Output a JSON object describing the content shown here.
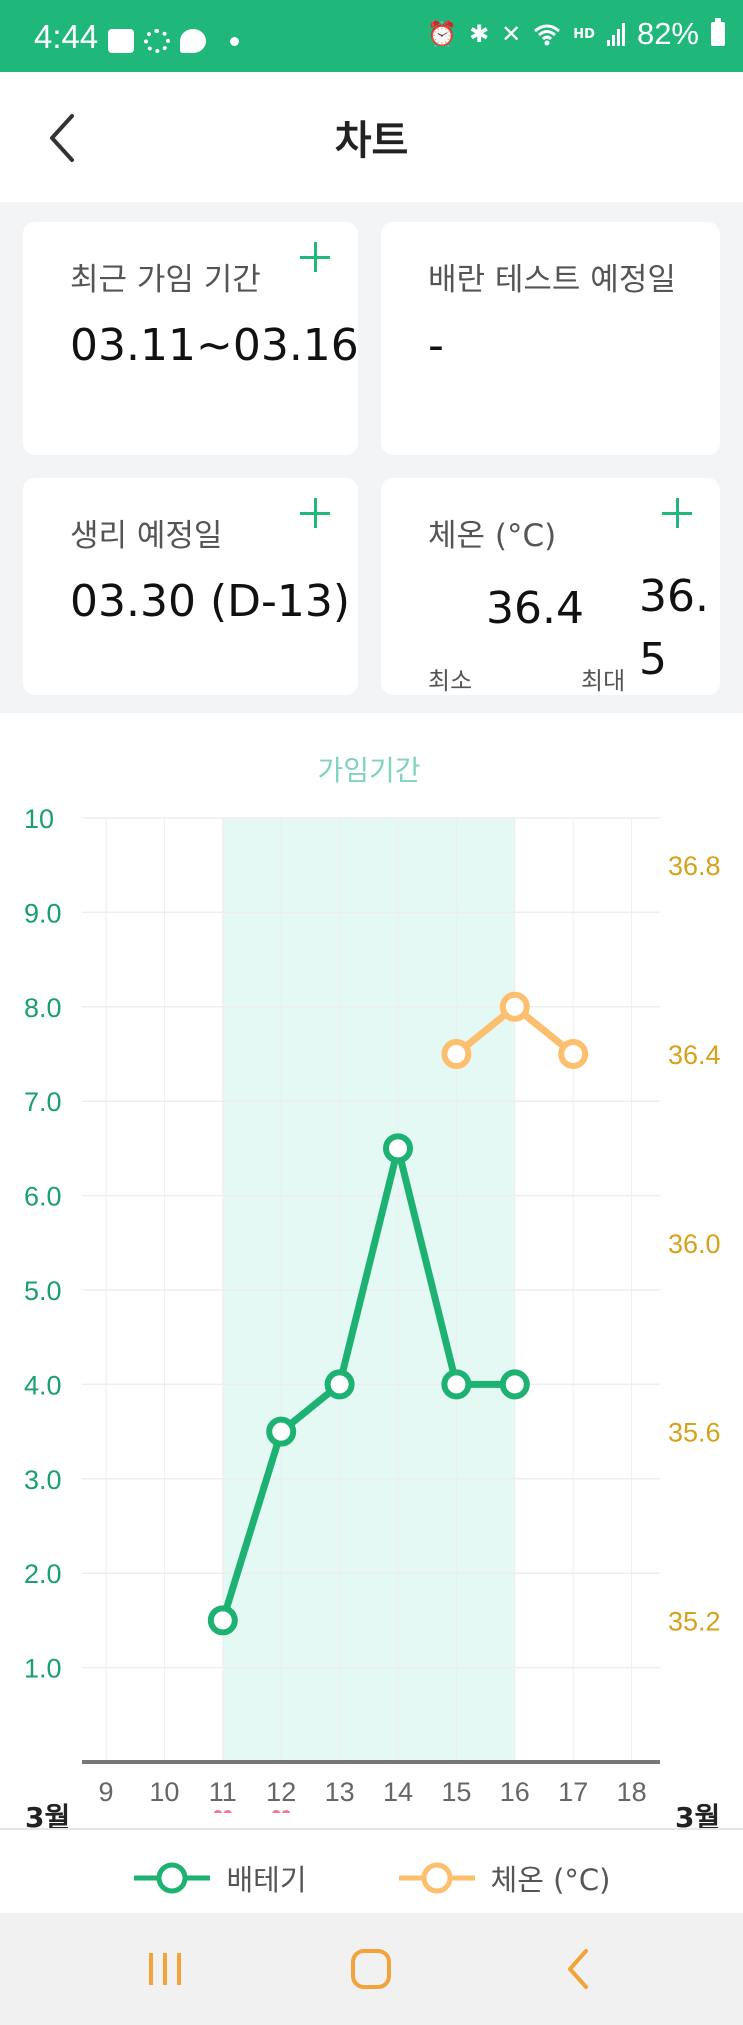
{
  "status_bar": {
    "time": "4:44",
    "hd_label": "HD",
    "battery_text": "82%",
    "icons": [
      "home-icon",
      "sync-icon",
      "talk-icon",
      "dot-icon",
      "alarm-icon",
      "bluetooth-icon",
      "mute-icon",
      "wifi-icon",
      "signal-icon",
      "battery-icon"
    ]
  },
  "header": {
    "title": "차트",
    "back_icon": "chevron-left-icon"
  },
  "cards": {
    "fertile": {
      "label": "최근 가임 기간",
      "value": "03.11~03.16"
    },
    "ovulation": {
      "label": "배란 테스트 예정일",
      "value": "-"
    },
    "period": {
      "label": "생리 예정일",
      "value": "03.30 (D-13)"
    },
    "temperature": {
      "label": "체온 (°C)",
      "min_value": "36.4",
      "max_value": "36.5",
      "min_label": "최소",
      "max_label": "최대"
    }
  },
  "chart_data": {
    "type": "line",
    "title": "가임기간",
    "categories": [
      "9",
      "10",
      "11",
      "12",
      "13",
      "14",
      "15",
      "16",
      "17",
      "18"
    ],
    "month_label_left": "3월",
    "month_label_right": "3월",
    "y_left": {
      "ticks": [
        "10",
        "9.0",
        "8.0",
        "7.0",
        "6.0",
        "5.0",
        "4.0",
        "3.0",
        "2.0",
        "1.0"
      ],
      "range": [
        0,
        10
      ]
    },
    "y_right": {
      "ticks": [
        "36.8",
        "36.4",
        "36.0",
        "35.6",
        "35.2"
      ],
      "range": [
        34.9,
        36.9
      ]
    },
    "highlight_range": [
      "11",
      "16"
    ],
    "heart_markers": [
      "11",
      "12"
    ],
    "series": [
      {
        "name": "배테기",
        "axis": "left",
        "color": "#1db172",
        "points": [
          [
            "11",
            1.5
          ],
          [
            "12",
            3.5
          ],
          [
            "13",
            4.0
          ],
          [
            "14",
            6.5
          ],
          [
            "15",
            4.0
          ],
          [
            "16",
            4.0
          ]
        ]
      },
      {
        "name": "체온 (°C)",
        "axis": "right",
        "color": "#fbbf6e",
        "points": [
          [
            "15",
            36.4
          ],
          [
            "16",
            36.5
          ],
          [
            "17",
            36.4
          ]
        ]
      }
    ],
    "colors": {
      "left_axis": "#1a9e73",
      "right_axis": "#d6a21c",
      "band": "#e4f8f4",
      "title": "#7fd3c0",
      "grid": "#eeeeee",
      "heart": "#f07c93"
    },
    "grid": true,
    "legend_position": "bottom"
  },
  "nav": {
    "recents_icon": "recents-icon",
    "home_icon": "home-button-icon",
    "back_icon": "back-arrow-icon"
  }
}
